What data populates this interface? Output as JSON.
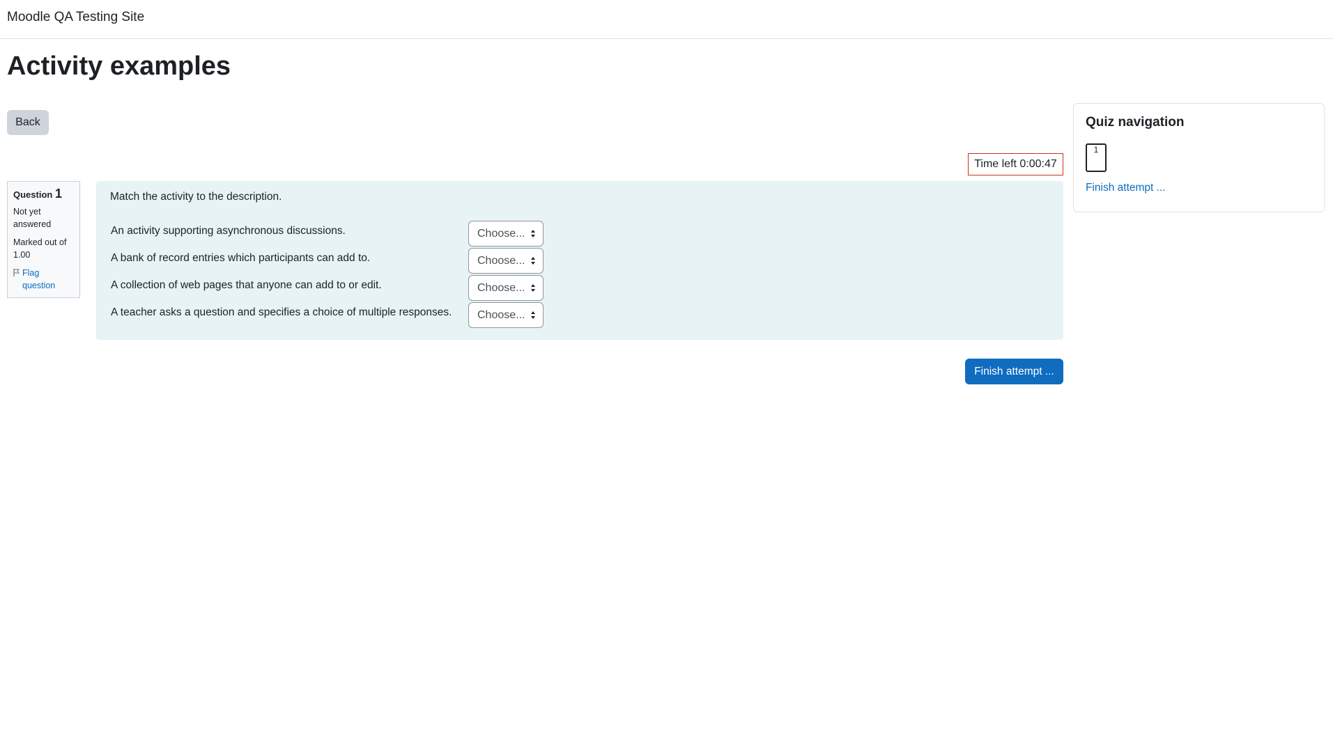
{
  "header": {
    "site_name": "Moodle QA Testing Site"
  },
  "page": {
    "title": "Activity examples"
  },
  "actions": {
    "back_label": "Back",
    "finish_label": "Finish attempt ..."
  },
  "timer": {
    "text": "Time left 0:00:47"
  },
  "question_info": {
    "label": "Question",
    "number": "1",
    "state": "Not yet answered",
    "grade": "Marked out of 1.00",
    "flag_label": "Flag question"
  },
  "question": {
    "text": "Match the activity to the description.",
    "rows": [
      {
        "stem": "An activity supporting asynchronous discussions.",
        "selected": "Choose..."
      },
      {
        "stem": "A bank of record entries which participants can add to.",
        "selected": "Choose..."
      },
      {
        "stem": "A collection of web pages that anyone can add to or edit.",
        "selected": "Choose..."
      },
      {
        "stem": "A teacher asks a question and specifies a choice of multiple responses.",
        "selected": "Choose..."
      }
    ]
  },
  "quiz_nav": {
    "title": "Quiz navigation",
    "buttons": [
      "1"
    ],
    "finish_link": "Finish attempt ..."
  },
  "icons": {
    "flag": "flag-icon",
    "select_caret": "sort-caret-icon"
  }
}
